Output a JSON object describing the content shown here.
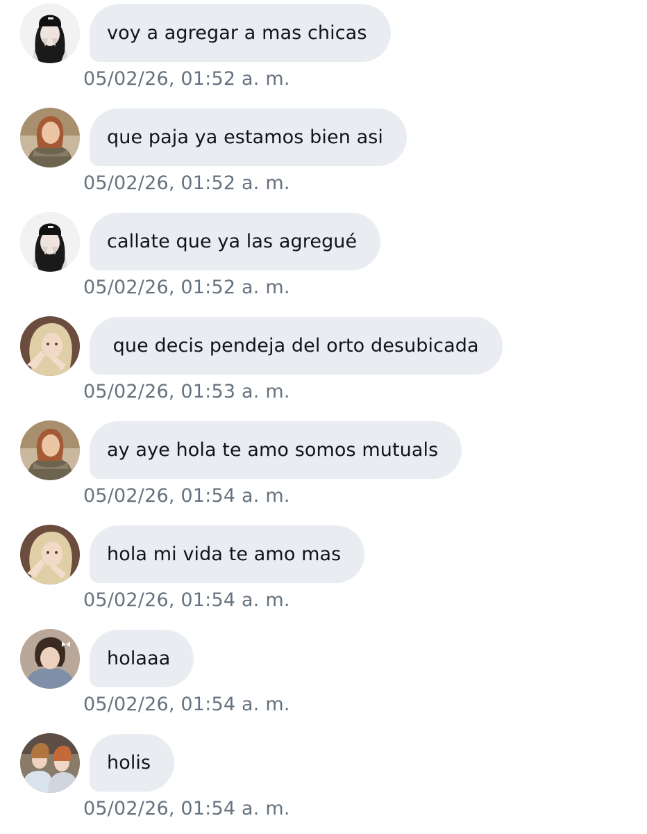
{
  "messages": [
    {
      "avatar": "avatar-user-beanie",
      "text": "voy a agregar a mas chicas",
      "timestamp": "05/02/26, 01:52 a. m."
    },
    {
      "avatar": "avatar-user-redhead",
      "text": "que paja ya estamos bien asi",
      "timestamp": "05/02/26, 01:52 a. m."
    },
    {
      "avatar": "avatar-user-beanie",
      "text": "callate que ya las agregué",
      "timestamp": "05/02/26, 01:52 a. m."
    },
    {
      "avatar": "avatar-user-blonde",
      "text": " que decis pendeja del orto desubicada",
      "timestamp": "05/02/26, 01:53 a. m."
    },
    {
      "avatar": "avatar-user-redhead",
      "text": "ay aye hola te amo somos mutuals",
      "timestamp": "05/02/26, 01:54 a. m."
    },
    {
      "avatar": "avatar-user-blonde",
      "text": "hola mi vida te amo mas",
      "timestamp": "05/02/26, 01:54 a. m."
    },
    {
      "avatar": "avatar-user-darkhair",
      "text": "holaaa",
      "timestamp": "05/02/26, 01:54 a. m."
    },
    {
      "avatar": "avatar-user-duo",
      "text": "holis",
      "timestamp": "05/02/26, 01:54 a. m."
    }
  ],
  "colors": {
    "bubble_background": "#e9edf1",
    "message_text": "#0f1419",
    "timestamp_text": "#66727f",
    "page_background": "#ffffff"
  }
}
